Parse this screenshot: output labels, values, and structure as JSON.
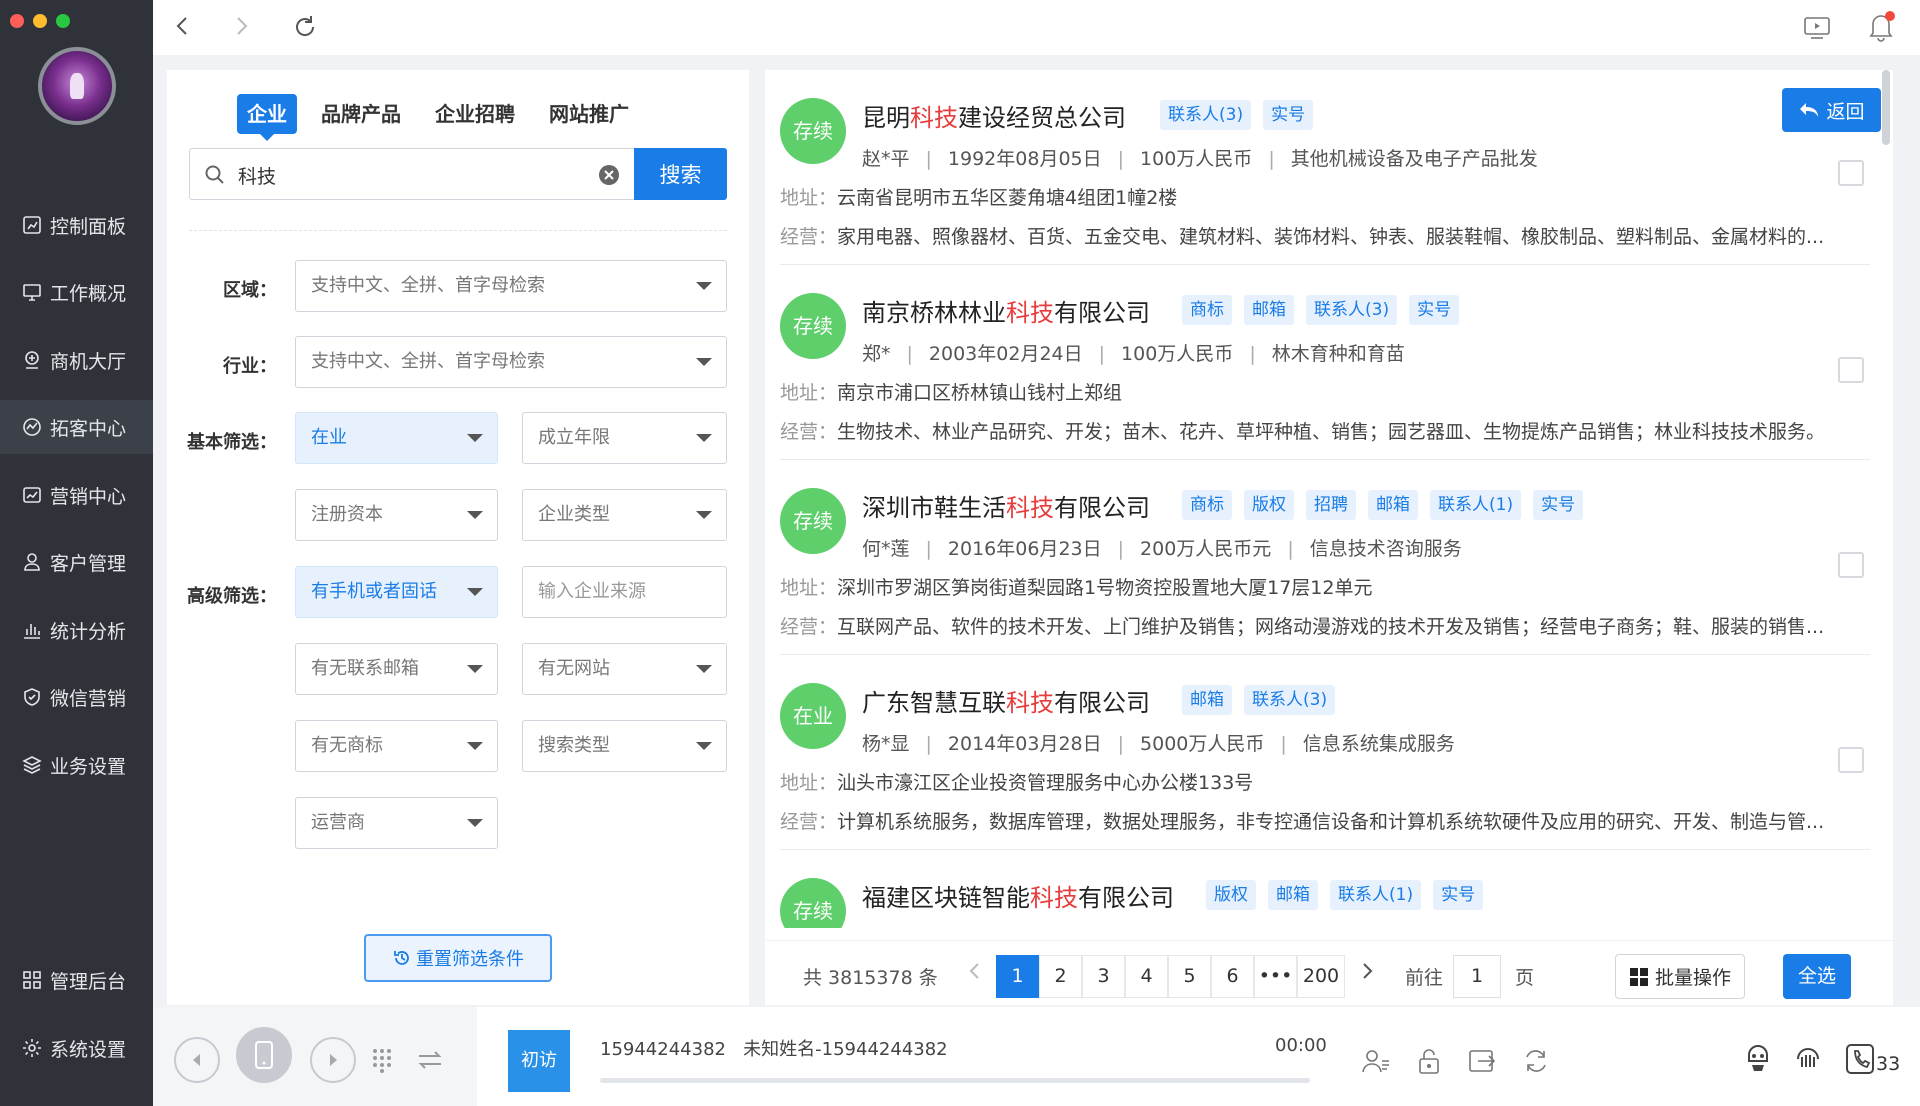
{
  "sidebar": {
    "window_controls": [
      "#ff5f57",
      "#febc2e",
      "#28c840"
    ],
    "items": [
      {
        "label": "控制面板",
        "icon": "dashboard-icon"
      },
      {
        "label": "工作概况",
        "icon": "monitor-icon"
      },
      {
        "label": "商机大厅",
        "icon": "opportunity-icon"
      },
      {
        "label": "拓客中心",
        "icon": "prospect-icon",
        "active": true
      },
      {
        "label": "营销中心",
        "icon": "chart-line-icon"
      },
      {
        "label": "客户管理",
        "icon": "user-icon"
      },
      {
        "label": "统计分析",
        "icon": "bar-chart-icon"
      },
      {
        "label": "微信营销",
        "icon": "shield-icon"
      },
      {
        "label": "业务设置",
        "icon": "layers-icon"
      }
    ],
    "bottom_items": [
      {
        "label": "管理后台",
        "icon": "grid-icon"
      },
      {
        "label": "系统设置",
        "icon": "gear-icon"
      }
    ]
  },
  "search": {
    "tabs": [
      "企业",
      "品牌产品",
      "企业招聘",
      "网站推广"
    ],
    "active_tab": "企业",
    "query": "科技",
    "button": "搜索"
  },
  "filters": {
    "region_label": "区域：",
    "region_placeholder": "支持中文、全拼、首字母检索",
    "industry_label": "行业：",
    "industry_placeholder": "支持中文、全拼、首字母检索",
    "basic_label": "基本筛选：",
    "status": "在业",
    "founded": "成立年限",
    "capital": "注册资本",
    "company_type": "企业类型",
    "advanced_label": "高级筛选：",
    "phone": "有手机或者固话",
    "source_placeholder": "输入企业来源",
    "email": "有无联系邮箱",
    "website": "有无网站",
    "trademark": "有无商标",
    "search_type": "搜索类型",
    "carrier": "运营商",
    "reset": "重置筛选条件"
  },
  "results": {
    "back_label": "返回",
    "addr_key": "地址：",
    "biz_key": "经营：",
    "companies": [
      {
        "status": "存续",
        "name_pre": "昆明",
        "name_hl": "科技",
        "name_post": "建设经贸总公司",
        "tags": [
          "联系人(3)",
          "实号"
        ],
        "legal": "赵*平",
        "date": "1992年08月05日",
        "capital": "100万人民币",
        "industry": "其他机械设备及电子产品批发",
        "address": "云南省昆明市五华区菱角塘4组团1幢2楼",
        "business": "家用电器、照像器材、百货、五金交电、建筑材料、装饰材料、钟表、服装鞋帽、橡胶制品、塑料制品、金属材料的..."
      },
      {
        "status": "存续",
        "name_pre": "南京桥林林业",
        "name_hl": "科技",
        "name_post": "有限公司",
        "tags": [
          "商标",
          "邮箱",
          "联系人(3)",
          "实号"
        ],
        "legal": "郑*",
        "date": "2003年02月24日",
        "capital": "100万人民币",
        "industry": "林木育种和育苗",
        "address": "南京市浦口区桥林镇山钱村上郑组",
        "business": "生物技术、林业产品研究、开发；苗木、花卉、草坪种植、销售；园艺器皿、生物提炼产品销售；林业科技技术服务。"
      },
      {
        "status": "存续",
        "name_pre": "深圳市鞋生活",
        "name_hl": "科技",
        "name_post": "有限公司",
        "tags": [
          "商标",
          "版权",
          "招聘",
          "邮箱",
          "联系人(1)",
          "实号"
        ],
        "legal": "何*莲",
        "date": "2016年06月23日",
        "capital": "200万人民币元",
        "industry": "信息技术咨询服务",
        "address": "深圳市罗湖区笋岗街道梨园路1号物资控股置地大厦17层12单元",
        "business": "互联网产品、软件的技术开发、上门维护及销售；网络动漫游戏的技术开发及销售；经营电子商务；鞋、服装的销售..."
      },
      {
        "status": "在业",
        "name_pre": "广东智慧互联",
        "name_hl": "科技",
        "name_post": "有限公司",
        "tags": [
          "邮箱",
          "联系人(3)"
        ],
        "legal": "杨*显",
        "date": "2014年03月28日",
        "capital": "5000万人民币",
        "industry": "信息系统集成服务",
        "address": "汕头市濠江区企业投资管理服务中心办公楼133号",
        "business": "计算机系统服务，数据库管理，数据处理服务，非专控通信设备和计算机系统软硬件及应用的研究、开发、制造与管..."
      },
      {
        "status": "存续",
        "name_pre": "福建区块链智能",
        "name_hl": "科技",
        "name_post": "有限公司",
        "tags": [
          "版权",
          "邮箱",
          "联系人(1)",
          "实号"
        ],
        "legal": "",
        "date": "",
        "capital": "",
        "industry": "",
        "address": "",
        "business": ""
      }
    ]
  },
  "pager": {
    "total": "共 3815378 条",
    "pages": [
      "1",
      "2",
      "3",
      "4",
      "5",
      "6",
      "•••",
      "200"
    ],
    "current": "1",
    "goto_label": "前往",
    "goto_value": "1",
    "page_suffix": "页",
    "batch": "批量操作",
    "select_all": "全选"
  },
  "callbar": {
    "visit": "初访",
    "phone": "15944244382",
    "contact": "未知姓名-15944244382",
    "timer": "00:00",
    "count": "33"
  },
  "colors": {
    "accent": "#1a7ce6",
    "highlight": "#e63c3c",
    "status_green": "#5ecf6b",
    "sidebar_bg": "#2f3238"
  }
}
